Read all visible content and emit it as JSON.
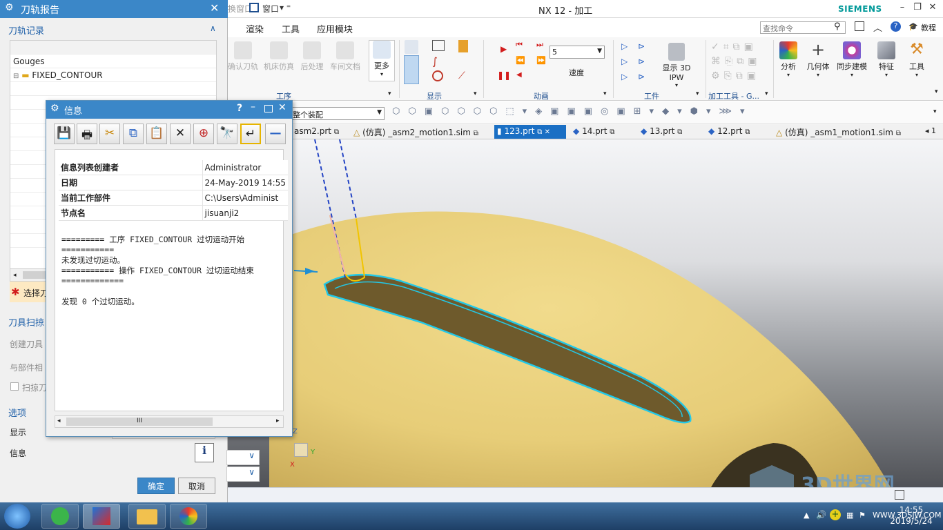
{
  "window": {
    "title": "NX 12 - 加工",
    "brand": "SIEMENS",
    "quick_access": "窗口",
    "quick_access_prefix": "换窗口",
    "help_label": "教程",
    "search_placeholder": "查找命令"
  },
  "menu": [
    "渲染",
    "工具",
    "应用模块"
  ],
  "ribbon": {
    "operation_buttons": [
      "确认刀轨",
      "机床仿真",
      "后处理",
      "车间文档"
    ],
    "more_label": "更多",
    "groups": [
      "工序",
      "显示",
      "动画",
      "工件",
      "加工工具 - G..."
    ],
    "speed_value": "5",
    "speed_label": "速度",
    "ipw_label": "显示 3D IPW",
    "right_buttons": [
      "分析",
      "几何体",
      "同步建模",
      "特征",
      "工具"
    ]
  },
  "toolbar2": {
    "assembly_filter": "整个装配"
  },
  "tabs": [
    {
      "label": "asm2.prt",
      "active": false
    },
    {
      "label": "(仿真) _asm2_motion1.sim",
      "active": false
    },
    {
      "label": "123.prt",
      "active": true
    },
    {
      "label": "14.prt",
      "active": false
    },
    {
      "label": "13.prt",
      "active": false
    },
    {
      "label": "12.prt",
      "active": false
    },
    {
      "label": "(仿真) _asm1_motion1.sim",
      "active": false
    }
  ],
  "tab_overflow": "1",
  "left_dialog": {
    "title": "刀轨报告",
    "section_records": "刀轨记录",
    "tree_header": "Gouges",
    "tree_item": "FIXED_CONTOUR",
    "select_hint": "选择刀",
    "section_sweep": "刀具扫掠",
    "create_sweep": "创建刀具",
    "relative_part": "与部件相",
    "sweep_checkbox": "扫掠刀",
    "section_options": "选项",
    "display_label": "显示",
    "info_label": "信息",
    "ok": "确定",
    "cancel": "取消"
  },
  "info_window": {
    "title": "信息",
    "rows": [
      {
        "key": "信息列表创建者",
        "value": "Administrator"
      },
      {
        "key": "日期",
        "value": "24-May-2019 14:55"
      },
      {
        "key": "当前工作部件",
        "value": "C:\\Users\\Administ"
      },
      {
        "key": "节点名",
        "value": "jisuanji2"
      }
    ],
    "text": "========= 工序 FIXED_CONTOUR 过切运动开始\n===========\n未发现过切运动。\n=========== 操作 FIXED_CONTOUR 过切运动结束\n=============\n\n发现 0 个过切运动。",
    "scroll_thumb": "III"
  },
  "viewport": {
    "axis_x": "X",
    "axis_y": "Y",
    "axis_z": "Z",
    "watermark_cn": "3D世界网",
    "watermark_url": "WWW.3DSJW.COM"
  },
  "taskbar": {
    "time": "14:55",
    "date": "2019/5/24"
  },
  "colors": {
    "accent": "#3b87c8",
    "part": "#ead27e",
    "highlight": "#22c8e8",
    "active_tab": "#1a6fc4"
  }
}
